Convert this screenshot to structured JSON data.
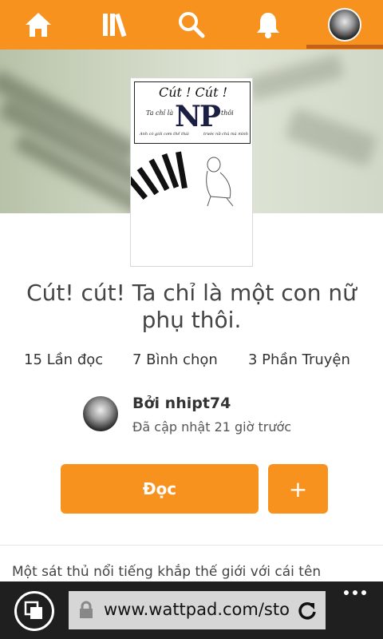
{
  "nav": {
    "items": [
      {
        "name": "home",
        "icon": "home-icon"
      },
      {
        "name": "library",
        "icon": "library-icon"
      },
      {
        "name": "search",
        "icon": "search-icon"
      },
      {
        "name": "notifications",
        "icon": "bell-icon"
      },
      {
        "name": "profile",
        "icon": "avatar"
      }
    ],
    "active": "profile",
    "accent_color": "#f7921e"
  },
  "cover": {
    "title": "Cút ! Cút !",
    "line_left": "Ta chỉ là",
    "big_text": "NP",
    "line_right": "thôi",
    "tagline_left": "Anh có giỏi cơm thế thái",
    "tagline_right": "trước nữ chủ mà mình"
  },
  "story": {
    "title": "Cút! cút! Ta chỉ là một con nữ phụ thôi.",
    "reads": "15 Lần đọc",
    "votes": "7 Bình chọn",
    "parts": "3 Phần Truyện"
  },
  "author": {
    "byline": "Bởi nhipt74",
    "updated": "Đã cập nhật 21 giờ trước"
  },
  "actions": {
    "read_label": "Đọc",
    "add_label": "+"
  },
  "description": "Một sát thủ nổi tiếng khắp thế giới với cái tên",
  "browser": {
    "url": "www.wattpad.com/sto",
    "lock_icon": "lock-icon",
    "refresh_icon": "refresh-icon",
    "more_icon": "more-dots-icon"
  }
}
